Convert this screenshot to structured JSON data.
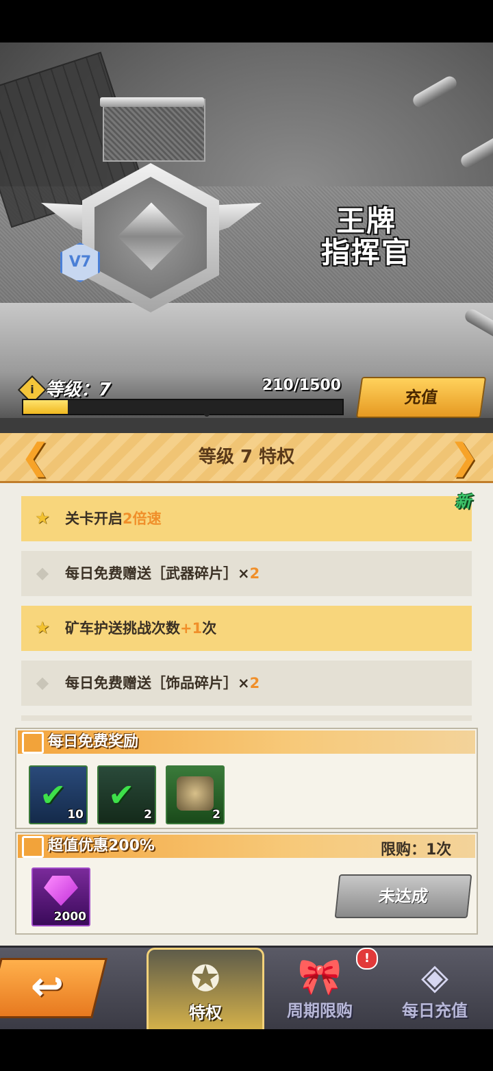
{
  "hero": {
    "rank_title_line1": "王牌",
    "rank_title_line2": "指挥官",
    "vip_badge": "V7"
  },
  "level": {
    "label": "等级：7",
    "progress_text": "210/1500",
    "progress_fraction": 0.14
  },
  "recharge_button": "充值",
  "privilege": {
    "title": "等级 7 特权",
    "prev_arrow": "❮",
    "next_arrow": "❯",
    "new_tag": "新",
    "perks": [
      {
        "pre": "关卡开启",
        "accent": "2倍速",
        "post": "",
        "icon": "star-icon"
      },
      {
        "pre": "每日免费赠送［武器碎片］×",
        "accent": "2",
        "post": "",
        "icon": "diamond-icon"
      },
      {
        "pre": "矿车护送挑战次数",
        "accent": "+1",
        "post": "次",
        "icon": "star-icon"
      },
      {
        "pre": "每日免费赠送［饰品碎片］×",
        "accent": "2",
        "post": "",
        "icon": "diamond-icon"
      }
    ]
  },
  "daily_reward": {
    "title": "每日免费奖励",
    "items": [
      {
        "name": "weapon-box-item",
        "count": "10",
        "claimed": true
      },
      {
        "name": "puzzle-piece-item",
        "count": "2",
        "claimed": true
      },
      {
        "name": "turret-piece-item",
        "count": "2",
        "claimed": false
      }
    ]
  },
  "super_deal": {
    "title": "超值优惠200%",
    "limit": "限购：1次",
    "item_count": "2000",
    "button": "未达成"
  },
  "nav": {
    "back": "↩",
    "tabs": [
      {
        "label": "特权",
        "icon": "medal-star-icon",
        "active": true
      },
      {
        "label": "周期限购",
        "icon": "gift-cycle-icon",
        "active": false
      },
      {
        "label": "每日充值",
        "icon": "money-bag-icon",
        "active": false
      }
    ],
    "alert_badge": "!"
  },
  "colors": {
    "accent_orange": "#f08f2a",
    "header_gold": "#f5d08a",
    "check_green": "#3ee04a"
  }
}
